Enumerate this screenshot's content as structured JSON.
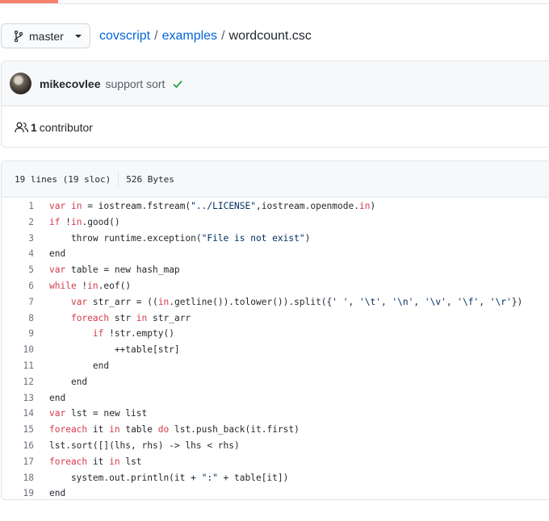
{
  "breadcrumb": {
    "branch": "master",
    "repo": "covscript",
    "folder": "examples",
    "file": "wordcount.csc",
    "separator": "/"
  },
  "commit": {
    "author": "mikecovlee",
    "message": "support sort",
    "status": "check-icon"
  },
  "contributors": {
    "count": "1",
    "label": "contributor"
  },
  "file_info": {
    "lines": "19 lines (19 sloc)",
    "size": "526 Bytes"
  },
  "code_lines": [
    {
      "n": "1",
      "tokens": [
        {
          "t": "var",
          "c": "kw"
        },
        {
          "t": " "
        },
        {
          "t": "in",
          "c": "kw"
        },
        {
          "t": " = iostream.fstream("
        },
        {
          "t": "\"../LICENSE\"",
          "c": "st"
        },
        {
          "t": ",iostream.openmode."
        },
        {
          "t": "in",
          "c": "kw"
        },
        {
          "t": ")"
        }
      ]
    },
    {
      "n": "2",
      "tokens": [
        {
          "t": "if",
          "c": "kw"
        },
        {
          "t": " !"
        },
        {
          "t": "in",
          "c": "kw"
        },
        {
          "t": ".good()"
        }
      ]
    },
    {
      "n": "3",
      "tokens": [
        {
          "t": "    throw runtime.exception("
        },
        {
          "t": "\"File is not exist\"",
          "c": "st"
        },
        {
          "t": ")"
        }
      ]
    },
    {
      "n": "4",
      "tokens": [
        {
          "t": "end"
        }
      ]
    },
    {
      "n": "5",
      "tokens": [
        {
          "t": "var",
          "c": "kw"
        },
        {
          "t": " table = new hash_map"
        }
      ]
    },
    {
      "n": "6",
      "tokens": [
        {
          "t": "while",
          "c": "kw"
        },
        {
          "t": " !"
        },
        {
          "t": "in",
          "c": "kw"
        },
        {
          "t": ".eof()"
        }
      ]
    },
    {
      "n": "7",
      "tokens": [
        {
          "t": "    "
        },
        {
          "t": "var",
          "c": "kw"
        },
        {
          "t": " str_arr = (("
        },
        {
          "t": "in",
          "c": "kw"
        },
        {
          "t": ".getline()).tolower()).split({"
        },
        {
          "t": "' '",
          "c": "st"
        },
        {
          "t": ", "
        },
        {
          "t": "'\\t'",
          "c": "st"
        },
        {
          "t": ", "
        },
        {
          "t": "'\\n'",
          "c": "st"
        },
        {
          "t": ", "
        },
        {
          "t": "'\\v'",
          "c": "st"
        },
        {
          "t": ", "
        },
        {
          "t": "'\\f'",
          "c": "st"
        },
        {
          "t": ", "
        },
        {
          "t": "'\\r'",
          "c": "st"
        },
        {
          "t": "})"
        }
      ]
    },
    {
      "n": "8",
      "tokens": [
        {
          "t": "    "
        },
        {
          "t": "foreach",
          "c": "kw"
        },
        {
          "t": " str "
        },
        {
          "t": "in",
          "c": "kw"
        },
        {
          "t": " str_arr"
        }
      ]
    },
    {
      "n": "9",
      "tokens": [
        {
          "t": "        "
        },
        {
          "t": "if",
          "c": "kw"
        },
        {
          "t": " !str.empty()"
        }
      ]
    },
    {
      "n": "10",
      "tokens": [
        {
          "t": "            ++table[str]"
        }
      ]
    },
    {
      "n": "11",
      "tokens": [
        {
          "t": "        end"
        }
      ]
    },
    {
      "n": "12",
      "tokens": [
        {
          "t": "    end"
        }
      ]
    },
    {
      "n": "13",
      "tokens": [
        {
          "t": "end"
        }
      ]
    },
    {
      "n": "14",
      "tokens": [
        {
          "t": "var",
          "c": "kw"
        },
        {
          "t": " lst = new list"
        }
      ]
    },
    {
      "n": "15",
      "tokens": [
        {
          "t": "foreach",
          "c": "kw"
        },
        {
          "t": " it "
        },
        {
          "t": "in",
          "c": "kw"
        },
        {
          "t": " table "
        },
        {
          "t": "do",
          "c": "kw"
        },
        {
          "t": " lst.push_back(it.first)"
        }
      ]
    },
    {
      "n": "16",
      "tokens": [
        {
          "t": "lst.sort([](lhs, rhs) -> lhs < rhs)"
        }
      ]
    },
    {
      "n": "17",
      "tokens": [
        {
          "t": "foreach",
          "c": "kw"
        },
        {
          "t": " it "
        },
        {
          "t": "in",
          "c": "kw"
        },
        {
          "t": " lst"
        }
      ]
    },
    {
      "n": "18",
      "tokens": [
        {
          "t": "    system.out.println(it + "
        },
        {
          "t": "\":\"",
          "c": "st"
        },
        {
          "t": " + table[it])"
        }
      ]
    },
    {
      "n": "19",
      "tokens": [
        {
          "t": "end"
        }
      ]
    }
  ],
  "colors": {
    "link": "#0366d6",
    "keyword": "#d73a49",
    "string": "#032f62",
    "success": "#28a745",
    "accent": "#f9826c"
  }
}
